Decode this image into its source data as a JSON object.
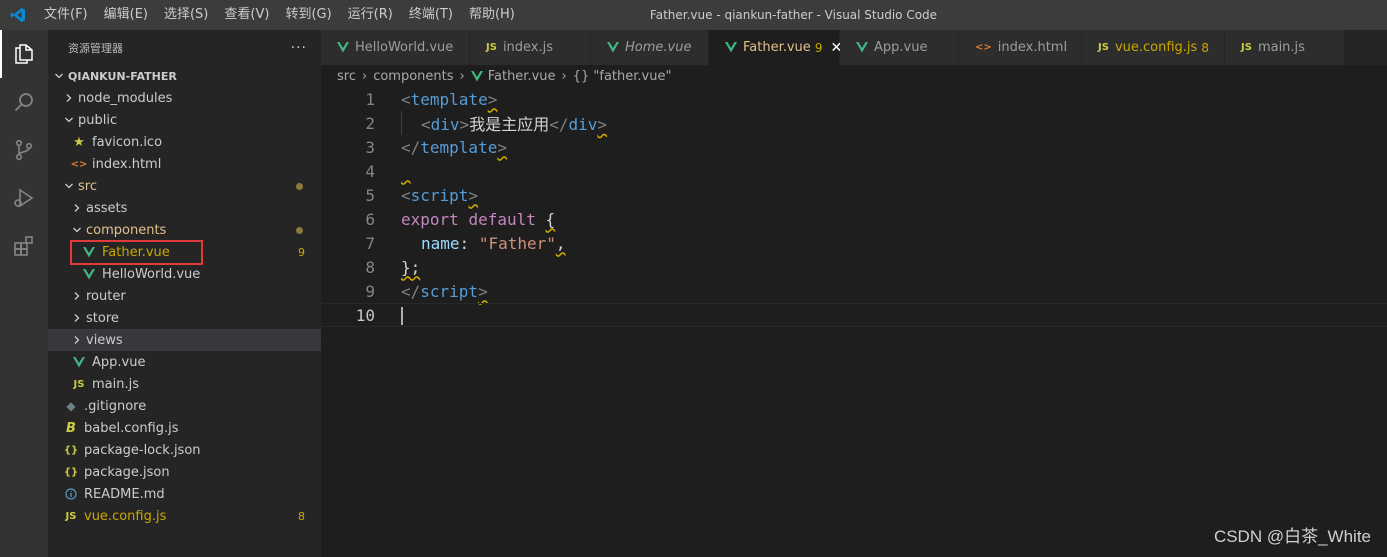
{
  "titlebar": {
    "menu": [
      "文件(F)",
      "编辑(E)",
      "选择(S)",
      "查看(V)",
      "转到(G)",
      "运行(R)",
      "终端(T)",
      "帮助(H)"
    ],
    "window_title": "Father.vue - qiankun-father - Visual Studio Code"
  },
  "activity_bar": [
    "explorer-icon",
    "search-icon",
    "source-control-icon",
    "run-debug-icon",
    "extensions-icon"
  ],
  "sidebar": {
    "header": "资源管理器",
    "more": "···",
    "root": "QIANKUN-FATHER",
    "items": [
      {
        "label": "node_modules",
        "type": "folder",
        "open": false
      },
      {
        "label": "public",
        "type": "folder",
        "open": true
      },
      {
        "label": "favicon.ico",
        "type": "star-file"
      },
      {
        "label": "index.html",
        "type": "html-file"
      },
      {
        "label": "src",
        "type": "folder",
        "open": true
      },
      {
        "label": "assets",
        "type": "folder",
        "open": false
      },
      {
        "label": "components",
        "type": "folder",
        "open": true
      },
      {
        "label": "Father.vue",
        "type": "vue-file",
        "badge": "9"
      },
      {
        "label": "HelloWorld.vue",
        "type": "vue-file"
      },
      {
        "label": "router",
        "type": "folder",
        "open": false
      },
      {
        "label": "store",
        "type": "folder",
        "open": false
      },
      {
        "label": "views",
        "type": "folder",
        "open": false
      },
      {
        "label": "App.vue",
        "type": "vue-file"
      },
      {
        "label": "main.js",
        "type": "js-file"
      },
      {
        "label": ".gitignore",
        "type": "git-file"
      },
      {
        "label": "babel.config.js",
        "type": "babel-file"
      },
      {
        "label": "package-lock.json",
        "type": "json-file"
      },
      {
        "label": "package.json",
        "type": "json-file"
      },
      {
        "label": "README.md",
        "type": "info-file"
      },
      {
        "label": "vue.config.js",
        "type": "js-file",
        "badge": "8"
      }
    ]
  },
  "tabs": [
    {
      "label": "HelloWorld.vue",
      "icon": "vue"
    },
    {
      "label": "index.js",
      "icon": "js"
    },
    {
      "label": "Home.vue",
      "icon": "vue",
      "italic": true
    },
    {
      "label": "Father.vue",
      "icon": "vue",
      "badge": "9",
      "active": true
    },
    {
      "label": "App.vue",
      "icon": "vue"
    },
    {
      "label": "index.html",
      "icon": "html"
    },
    {
      "label": "vue.config.js",
      "icon": "js",
      "badge": "8"
    },
    {
      "label": "main.js",
      "icon": "js"
    }
  ],
  "breadcrumb": [
    "src",
    "components",
    "Father.vue",
    "{} \"father.vue\""
  ],
  "editor": {
    "line_numbers": [
      "1",
      "2",
      "3",
      "4",
      "5",
      "6",
      "7",
      "8",
      "9",
      "10"
    ],
    "lines": {
      "l1_open": "<",
      "l1_tag": "template",
      "l1_close": ">",
      "l2_open": "<",
      "l2_tag": "div",
      "l2_mid": ">",
      "l2_text": "我是主应用",
      "l2_open2": "</",
      "l2_tag2": "div",
      "l2_close": ">",
      "l3_open": "</",
      "l3_tag": "template",
      "l3_close": ">",
      "l5_open": "<",
      "l5_tag": "script",
      "l5_close": ">",
      "l6_kw1": "export",
      "l6_kw2": "default",
      "l6_brace": "{",
      "l7_prop": "name",
      "l7_colon": ":",
      "l7_str": "\"Father\"",
      "l7_comma": ",",
      "l8_text": "};",
      "l9_open": "</",
      "l9_tag": "script",
      "l9_close": ">"
    }
  },
  "watermark": "CSDN @白茶_White",
  "colors": {
    "accent_modified": "#e2c08d",
    "warning": "#cca700",
    "vue": "#41b883",
    "js": "#cbcb41",
    "html": "#e37933",
    "highlight_box": "#e03a3a"
  }
}
